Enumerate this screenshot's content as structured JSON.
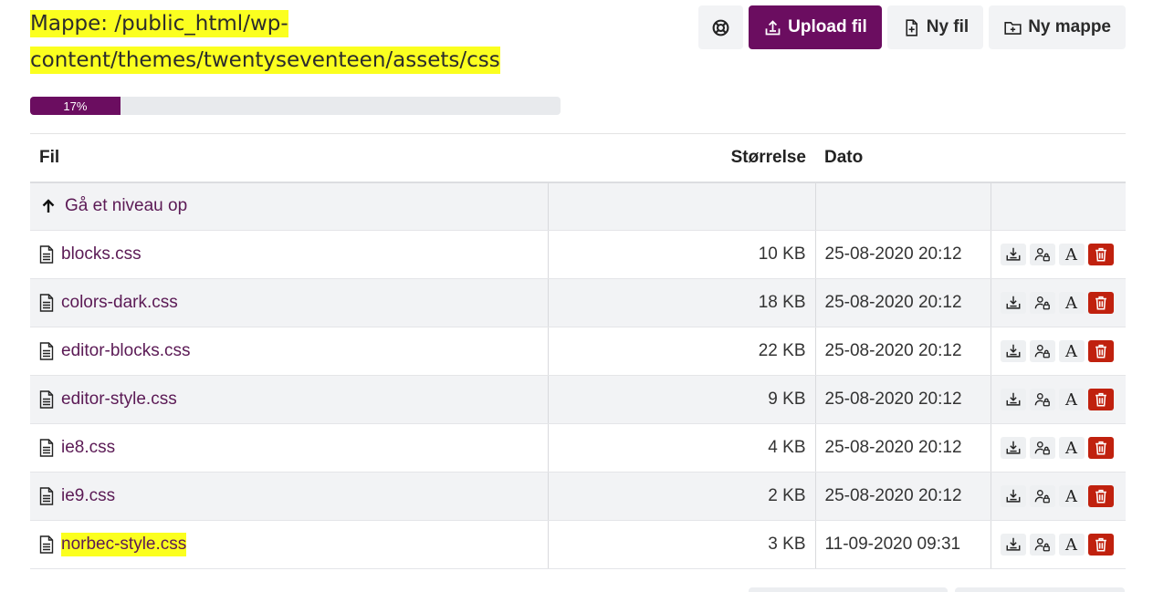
{
  "folder": {
    "line1": "Mappe: /public_html/wp-",
    "line2": "content/themes/twentyseventeen/assets/css"
  },
  "toolbar": {
    "help_icon": "lifebuoy-icon",
    "upload_label": "Upload fil",
    "new_file_label": "Ny fil",
    "new_folder_label": "Ny mappe"
  },
  "progress": {
    "value": 0.17,
    "label": "17%"
  },
  "table": {
    "headers": {
      "file": "Fil",
      "size": "Størrelse",
      "date": "Dato"
    },
    "up_label": "Gå et niveau op",
    "rows": [
      {
        "name": "blocks.css",
        "size": "10 KB",
        "date": "25-08-2020 20:12"
      },
      {
        "name": "colors-dark.css",
        "size": "18 KB",
        "date": "25-08-2020 20:12"
      },
      {
        "name": "editor-blocks.css",
        "size": "22 KB",
        "date": "25-08-2020 20:12"
      },
      {
        "name": "editor-style.css",
        "size": "9 KB",
        "date": "25-08-2020 20:12"
      },
      {
        "name": "ie8.css",
        "size": "4 KB",
        "date": "25-08-2020 20:12"
      },
      {
        "name": "ie9.css",
        "size": "2 KB",
        "date": "25-08-2020 20:12"
      },
      {
        "name": "norbec-style.css",
        "size": "3 KB",
        "date": "11-09-2020 09:31"
      }
    ],
    "rename_glyph": "A"
  },
  "colors": {
    "brand": "#6b0d60",
    "highlight": "#fbff1f",
    "danger": "#c0210e"
  }
}
